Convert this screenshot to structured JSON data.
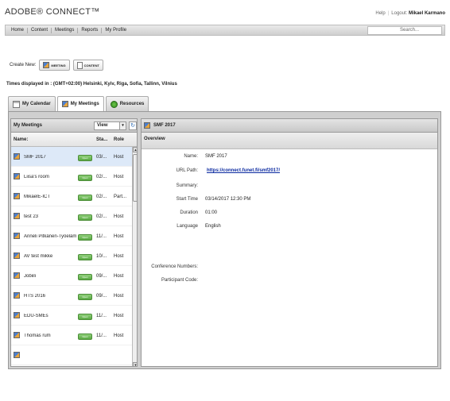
{
  "brand": "ADOBE® CONNECT™",
  "top_links": {
    "help": "Help",
    "logout_label": "Logout:",
    "user": "Mikael Karmano"
  },
  "nav": {
    "items": [
      "Home",
      "Content",
      "Meetings",
      "Reports",
      "My Profile"
    ],
    "search_placeholder": "Search..."
  },
  "create_new": {
    "label": "Create New:",
    "meeting": "MEETING",
    "content": "CONTENT"
  },
  "timezone": "Times displayed in : (GMT+02:00) Helsinki, Kyiv, Riga, Sofia, Tallinn, Vilnius",
  "tabs": [
    "My Calendar",
    "My Meetings",
    "Resources"
  ],
  "left_panel": {
    "title": "My Meetings",
    "view_label": "View",
    "columns": {
      "name": "Name:",
      "status": "Sta...",
      "role": "Role"
    },
    "rows": [
      {
        "name": "SMF 2017",
        "open": "Open",
        "status": "03/...",
        "role": "Host"
      },
      {
        "name": "Liisa's room",
        "open": "Open",
        "status": "02/...",
        "role": "Host"
      },
      {
        "name": "MikaelE-ICT",
        "open": "Open",
        "status": "02/...",
        "role": "Part..."
      },
      {
        "name": "test 23",
        "open": "Open",
        "status": "02/...",
        "role": "Host"
      },
      {
        "name": "Anneli Pitkänen-Työeläm...",
        "open": "Open",
        "status": "11/...",
        "role": "Host"
      },
      {
        "name": "AV test mikke",
        "open": "Open",
        "status": "10/...",
        "role": "Host"
      },
      {
        "name": "Jobiili",
        "open": "Open",
        "status": "09/...",
        "role": "Host"
      },
      {
        "name": "HTS 2016",
        "open": "Open",
        "status": "09/...",
        "role": "Host"
      },
      {
        "name": "EDU-SMEs",
        "open": "Open",
        "status": "11/...",
        "role": "Host"
      },
      {
        "name": "Thomas rum",
        "open": "Open",
        "status": "11/...",
        "role": "Host"
      }
    ]
  },
  "right_panel": {
    "title": "SMF 2017",
    "overview": "Overview",
    "fields": {
      "name_label": "Name:",
      "name": "SMF 2017",
      "url_label": "URL Path:",
      "url": "https://connect.funet.fi/smf2017/",
      "summary_label": "Summary:",
      "start_label": "Start Time",
      "start": "03/14/2017 12:30 PM",
      "duration_label": "Duration",
      "duration": "01:00",
      "language_label": "Language",
      "language": "English",
      "conf_label": "Conference Numbers:",
      "participant_label": "Participant Code:"
    }
  }
}
